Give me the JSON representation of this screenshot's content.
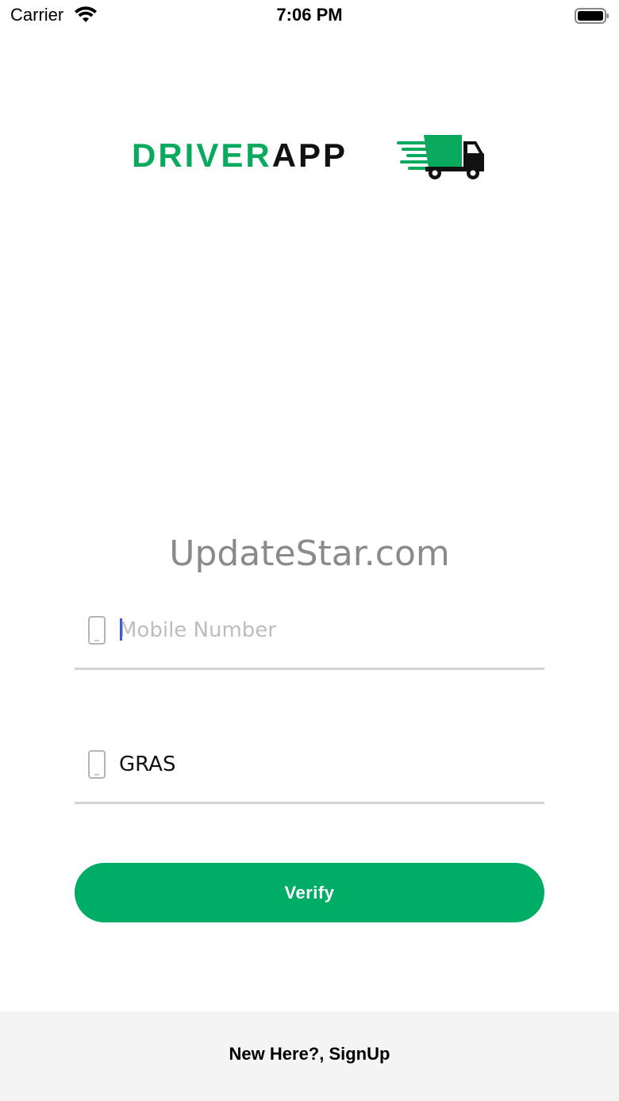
{
  "status_bar": {
    "carrier": "Carrier",
    "time": "7:06 PM"
  },
  "logo": {
    "text_green": "DRIVER",
    "text_black": "APP",
    "brand_green": "#0aaa5e",
    "icon": "truck-icon"
  },
  "watermark": {
    "text": "UpdateStar.com"
  },
  "form": {
    "mobile": {
      "value": "",
      "placeholder": "Mobile Number",
      "icon": "mobile-phone-icon"
    },
    "second": {
      "value": "GRAS",
      "placeholder": "",
      "icon": "mobile-phone-icon"
    },
    "verify_label": "Verify",
    "button_color": "#00ad66"
  },
  "footer": {
    "signup_label": "New Here?, SignUp"
  }
}
